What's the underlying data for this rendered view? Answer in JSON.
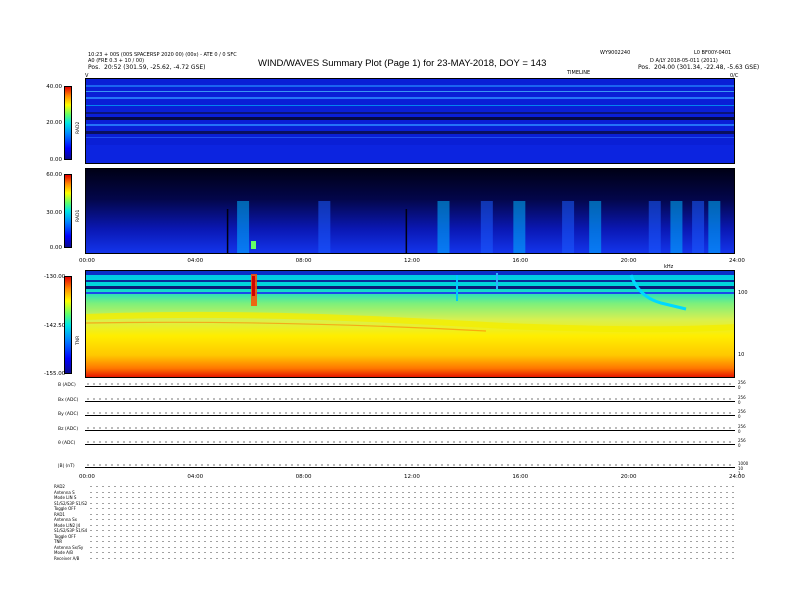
{
  "header": {
    "title": "WIND/WAVES Summary Plot (Page 1) for 23-MAY-2018, DOY = 143",
    "left_line1": "10:23 + 00S (00S SPACERSP 2020 00) (00x) - ATE 0 / 0 SFC",
    "left_line2": "A0 (FRE 0.3 + 10 / 00)",
    "left_pos_label": "Pos.",
    "left_pos_value": "20:52 (301.59, -25.62, -4.72 GSE)",
    "right_code_1": "WY9002240",
    "right_code_2": "L0 BF00Y-0401",
    "right_line2": "D A/LY 2018-05-011 (2011)",
    "right_pos_label": "Pos.",
    "right_pos_value": "204.00 (301.34, -22.48, -5.63 GSE)",
    "timeline_label": "TIMELINE",
    "corner_left": "V",
    "corner_right": "0/C"
  },
  "chart_data": [
    {
      "type": "heatmap",
      "name": "RAD2",
      "ylabel": "RAD2",
      "colorbar_ticks": [
        "40.00",
        "20.00",
        "0.00"
      ],
      "colorbar_range": [
        0,
        40
      ],
      "dominant": "blue background with faint horizontal interference lines"
    },
    {
      "type": "heatmap",
      "name": "RAD1",
      "ylabel": "RAD1",
      "colorbar_ticks": [
        "60.00",
        "30.00",
        "0.00"
      ],
      "colorbar_range": [
        0,
        60
      ],
      "x_ticks": [
        "00:00",
        "04:00",
        "08:00",
        "12:00",
        "16:00",
        "20:00",
        "24:00"
      ],
      "burst_hours": [
        5.8,
        8.8,
        13.2,
        14.8,
        16.0,
        17.8,
        18.8,
        21.0,
        21.8,
        22.6,
        23.2
      ]
    },
    {
      "type": "heatmap",
      "name": "TNR",
      "ylabel": "TNR",
      "colorbar_ticks": [
        "-130.00",
        "-142.50",
        "-155.00"
      ],
      "colorbar_range": [
        -155,
        -130
      ],
      "right_axis_label": "kHz",
      "right_axis_ticks": [
        "100",
        "10"
      ],
      "x_ticks": [
        "00:00",
        "04:00",
        "08:00",
        "12:00",
        "16:00",
        "20:00",
        "24:00"
      ]
    },
    {
      "type": "line",
      "name": "magnetometer_traces",
      "series": [
        {
          "name": "B (ADC)",
          "right_ticks": [
            "256",
            "0"
          ]
        },
        {
          "name": "Bx (ADC)",
          "right_ticks": [
            "256",
            "0"
          ]
        },
        {
          "name": "By (ADC)",
          "right_ticks": [
            "256",
            "0"
          ]
        },
        {
          "name": "Bz (ADC)",
          "right_ticks": [
            "256",
            "0"
          ]
        },
        {
          "name": "θ (ADC)",
          "right_ticks": [
            "256",
            "0"
          ]
        },
        {
          "name": "|B| (nT)",
          "right_ticks": [
            "1000",
            "10",
            "1"
          ]
        }
      ],
      "x_ticks": [
        "00:00",
        "04:00",
        "08:00",
        "12:00",
        "16:00",
        "20:00",
        "24:00"
      ]
    }
  ],
  "info_rows": [
    "RAD2",
    "Antenna    S",
    "Mode    LIN  S",
    "S1/S2/S3P   S1/S2",
    "Toggle    OFF",
    "RAD1",
    "Antenna    Sx",
    "Mode   LIN2 J4",
    "S1/S2/S3P  S1/S4",
    "Toggle    OFF",
    "TNR",
    "Antenna   Sx/Sy",
    "Mode    A/B",
    "Receiver    A/B"
  ]
}
